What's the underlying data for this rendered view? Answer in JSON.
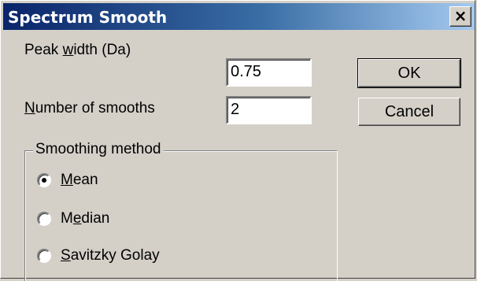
{
  "window": {
    "title": "Spectrum Smooth",
    "close_glyph": "×"
  },
  "fields": {
    "peak_width": {
      "label_pre": "Peak ",
      "label_mnemonic": "w",
      "label_post": "idth (Da)",
      "value": "0.75"
    },
    "num_smooths": {
      "label_pre": "",
      "label_mnemonic": "N",
      "label_post": "umber of smooths",
      "value": "2"
    }
  },
  "buttons": {
    "ok": "OK",
    "cancel": "Cancel"
  },
  "smoothing": {
    "legend": "Smoothing method",
    "options": [
      {
        "pre": "",
        "mnemonic": "M",
        "post": "ean",
        "selected": true
      },
      {
        "pre": "M",
        "mnemonic": "e",
        "post": "dian",
        "selected": false
      },
      {
        "pre": "",
        "mnemonic": "S",
        "post": "avitzky Golay",
        "selected": false
      }
    ]
  }
}
